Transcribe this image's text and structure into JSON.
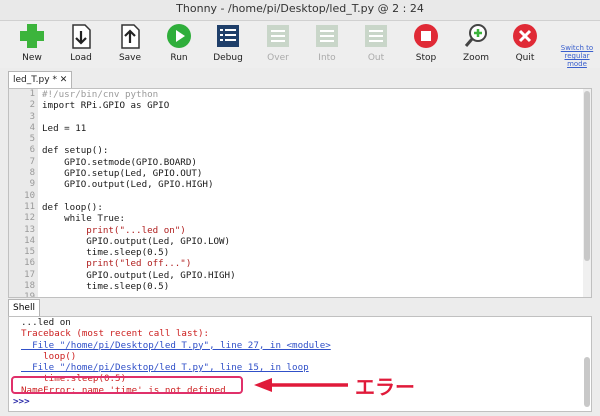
{
  "window": {
    "title": "Thonny - /home/pi/Desktop/led_T.py @ 2 : 24"
  },
  "toolbar": {
    "buttons": [
      {
        "label": "New",
        "icon": "new-icon"
      },
      {
        "label": "Load",
        "icon": "load-icon"
      },
      {
        "label": "Save",
        "icon": "save-icon"
      },
      {
        "label": "Run",
        "icon": "run-icon"
      },
      {
        "label": "Debug",
        "icon": "debug-icon"
      },
      {
        "label": "Over",
        "icon": "step-over-icon"
      },
      {
        "label": "Into",
        "icon": "step-into-icon"
      },
      {
        "label": "Out",
        "icon": "step-out-icon"
      },
      {
        "label": "Stop",
        "icon": "stop-icon"
      },
      {
        "label": "Zoom",
        "icon": "zoom-icon"
      },
      {
        "label": "Quit",
        "icon": "quit-icon"
      }
    ],
    "switch_mode": "Switch to regular mode"
  },
  "editor": {
    "tab_label": "led_T.py * ✕",
    "line_numbers": [
      "1",
      "2",
      "3",
      "4",
      "5",
      "6",
      "7",
      "8",
      "9",
      "10",
      "11",
      "12",
      "13",
      "14",
      "15",
      "16",
      "17",
      "18",
      "19"
    ],
    "lines": [
      "#!/usr/bin/cnv python",
      "import RPi.GPIO as GPIO",
      "",
      "Led = 11",
      "",
      "def setup():",
      "    GPIO.setmode(GPIO.BOARD)",
      "    GPIO.setup(Led, GPIO.OUT)",
      "    GPIO.output(Led, GPIO.HIGH)",
      "",
      "def loop():",
      "    while True:",
      "        print(\"...led on\")",
      "        GPIO.output(Led, GPIO.LOW)",
      "        time.sleep(0.5)",
      "        print(\"led off...\")",
      "        GPIO.output(Led, GPIO.HIGH)",
      "        time.sleep(0.5)",
      ""
    ]
  },
  "shell": {
    "tab_label": "Shell",
    "lines": [
      "...led on",
      "Traceback (most recent call last):",
      "  File \"/home/pi/Desktop/led_T.py\", line 27, in <module>",
      "    loop()",
      "  File \"/home/pi/Desktop/led_T.py\", line 15, in loop",
      "    time.sleep(0.5)",
      "NameError: name 'time' is not defined"
    ],
    "prompt": ">>>"
  },
  "annotation": {
    "label": "エラー",
    "color": "#e01a3a"
  }
}
